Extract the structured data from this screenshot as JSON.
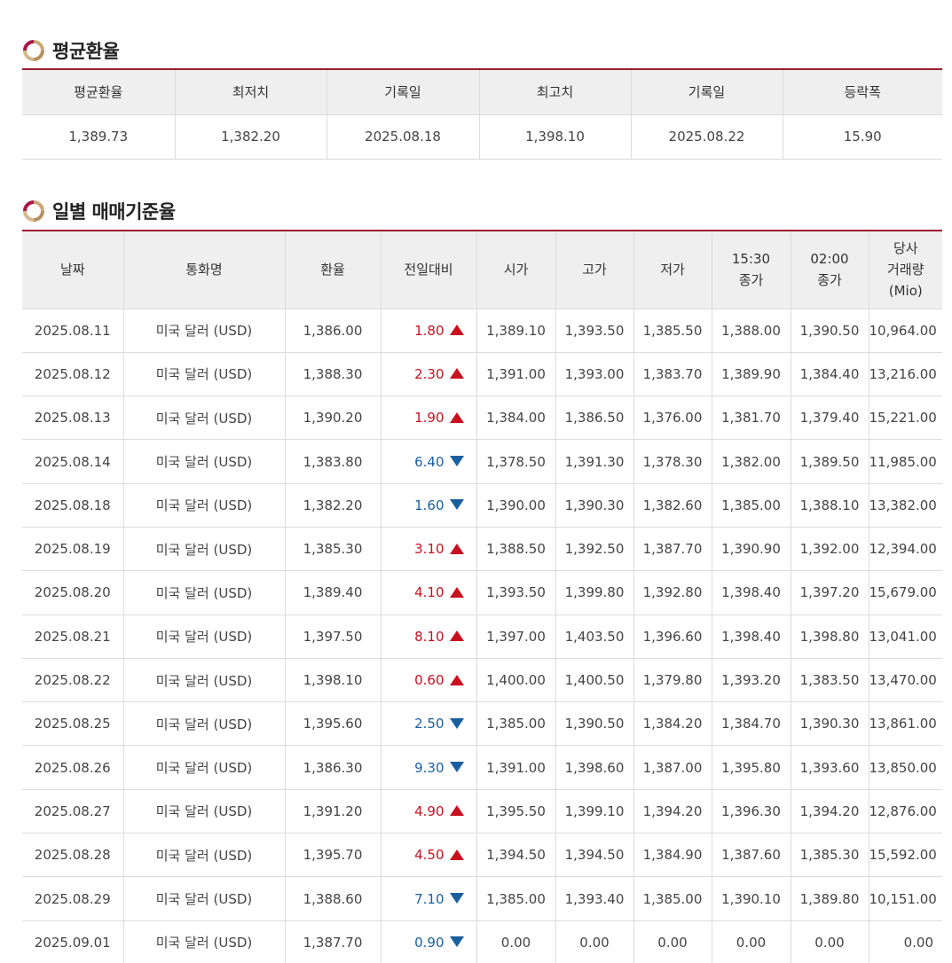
{
  "average_section": {
    "title": "평균환율",
    "headers": [
      "평균환율",
      "최저치",
      "기록일",
      "최고치",
      "기록일",
      "등락폭"
    ],
    "values": [
      "1,389.73",
      "1,382.20",
      "2025.08.18",
      "1,398.10",
      "2025.08.22",
      "15.90"
    ]
  },
  "daily_section": {
    "title": "일별 매매기준율",
    "headers": [
      [
        "날짜"
      ],
      [
        "통화명"
      ],
      [
        "환율"
      ],
      [
        "전일대비"
      ],
      [
        "시가"
      ],
      [
        "고가"
      ],
      [
        "저가"
      ],
      [
        "15:30",
        "종가"
      ],
      [
        "02:00",
        "종가"
      ],
      [
        "당사",
        "거래량",
        "(Mio)"
      ]
    ],
    "rows": [
      {
        "date": "2025.08.11",
        "currency": "미국 달러 (USD)",
        "rate": "1,386.00",
        "change": "1.80",
        "direction": "up",
        "open": "1,389.10",
        "high": "1,393.50",
        "low": "1,385.50",
        "close1530": "1,388.00",
        "close0200": "1,390.50",
        "volume": "10,964.00"
      },
      {
        "date": "2025.08.12",
        "currency": "미국 달러 (USD)",
        "rate": "1,388.30",
        "change": "2.30",
        "direction": "up",
        "open": "1,391.00",
        "high": "1,393.00",
        "low": "1,383.70",
        "close1530": "1,389.90",
        "close0200": "1,384.40",
        "volume": "13,216.00"
      },
      {
        "date": "2025.08.13",
        "currency": "미국 달러 (USD)",
        "rate": "1,390.20",
        "change": "1.90",
        "direction": "up",
        "open": "1,384.00",
        "high": "1,386.50",
        "low": "1,376.00",
        "close1530": "1,381.70",
        "close0200": "1,379.40",
        "volume": "15,221.00"
      },
      {
        "date": "2025.08.14",
        "currency": "미국 달러 (USD)",
        "rate": "1,383.80",
        "change": "6.40",
        "direction": "down",
        "open": "1,378.50",
        "high": "1,391.30",
        "low": "1,378.30",
        "close1530": "1,382.00",
        "close0200": "1,389.50",
        "volume": "11,985.00"
      },
      {
        "date": "2025.08.18",
        "currency": "미국 달러 (USD)",
        "rate": "1,382.20",
        "change": "1.60",
        "direction": "down",
        "open": "1,390.00",
        "high": "1,390.30",
        "low": "1,382.60",
        "close1530": "1,385.00",
        "close0200": "1,388.10",
        "volume": "13,382.00"
      },
      {
        "date": "2025.08.19",
        "currency": "미국 달러 (USD)",
        "rate": "1,385.30",
        "change": "3.10",
        "direction": "up",
        "open": "1,388.50",
        "high": "1,392.50",
        "low": "1,387.70",
        "close1530": "1,390.90",
        "close0200": "1,392.00",
        "volume": "12,394.00"
      },
      {
        "date": "2025.08.20",
        "currency": "미국 달러 (USD)",
        "rate": "1,389.40",
        "change": "4.10",
        "direction": "up",
        "open": "1,393.50",
        "high": "1,399.80",
        "low": "1,392.80",
        "close1530": "1,398.40",
        "close0200": "1,397.20",
        "volume": "15,679.00"
      },
      {
        "date": "2025.08.21",
        "currency": "미국 달러 (USD)",
        "rate": "1,397.50",
        "change": "8.10",
        "direction": "up",
        "open": "1,397.00",
        "high": "1,403.50",
        "low": "1,396.60",
        "close1530": "1,398.40",
        "close0200": "1,398.80",
        "volume": "13,041.00"
      },
      {
        "date": "2025.08.22",
        "currency": "미국 달러 (USD)",
        "rate": "1,398.10",
        "change": "0.60",
        "direction": "up",
        "open": "1,400.00",
        "high": "1,400.50",
        "low": "1,379.80",
        "close1530": "1,393.20",
        "close0200": "1,383.50",
        "volume": "13,470.00"
      },
      {
        "date": "2025.08.25",
        "currency": "미국 달러 (USD)",
        "rate": "1,395.60",
        "change": "2.50",
        "direction": "down",
        "open": "1,385.00",
        "high": "1,390.50",
        "low": "1,384.20",
        "close1530": "1,384.70",
        "close0200": "1,390.30",
        "volume": "13,861.00"
      },
      {
        "date": "2025.08.26",
        "currency": "미국 달러 (USD)",
        "rate": "1,386.30",
        "change": "9.30",
        "direction": "down",
        "open": "1,391.00",
        "high": "1,398.60",
        "low": "1,387.00",
        "close1530": "1,395.80",
        "close0200": "1,393.60",
        "volume": "13,850.00"
      },
      {
        "date": "2025.08.27",
        "currency": "미국 달러 (USD)",
        "rate": "1,391.20",
        "change": "4.90",
        "direction": "up",
        "open": "1,395.50",
        "high": "1,399.10",
        "low": "1,394.20",
        "close1530": "1,396.30",
        "close0200": "1,394.20",
        "volume": "12,876.00"
      },
      {
        "date": "2025.08.28",
        "currency": "미국 달러 (USD)",
        "rate": "1,395.70",
        "change": "4.50",
        "direction": "up",
        "open": "1,394.50",
        "high": "1,394.50",
        "low": "1,384.90",
        "close1530": "1,387.60",
        "close0200": "1,385.30",
        "volume": "15,592.00"
      },
      {
        "date": "2025.08.29",
        "currency": "미국 달러 (USD)",
        "rate": "1,388.60",
        "change": "7.10",
        "direction": "down",
        "open": "1,385.00",
        "high": "1,393.40",
        "low": "1,385.00",
        "close1530": "1,390.10",
        "close0200": "1,389.80",
        "volume": "10,151.00"
      },
      {
        "date": "2025.09.01",
        "currency": "미국 달러 (USD)",
        "rate": "1,387.70",
        "change": "0.90",
        "direction": "down",
        "open": "0.00",
        "high": "0.00",
        "low": "0.00",
        "close1530": "0.00",
        "close0200": "0.00",
        "volume": "0.00"
      }
    ]
  },
  "colors": {
    "accent_line": "#9b1c2e",
    "up": "#c8101f",
    "down": "#1a5fa0",
    "header_bg": "#efefef"
  },
  "icons": {
    "section_logo": "circular-bank-logo-icon",
    "up_arrow": "triangle-up-icon",
    "down_arrow": "triangle-down-icon"
  }
}
